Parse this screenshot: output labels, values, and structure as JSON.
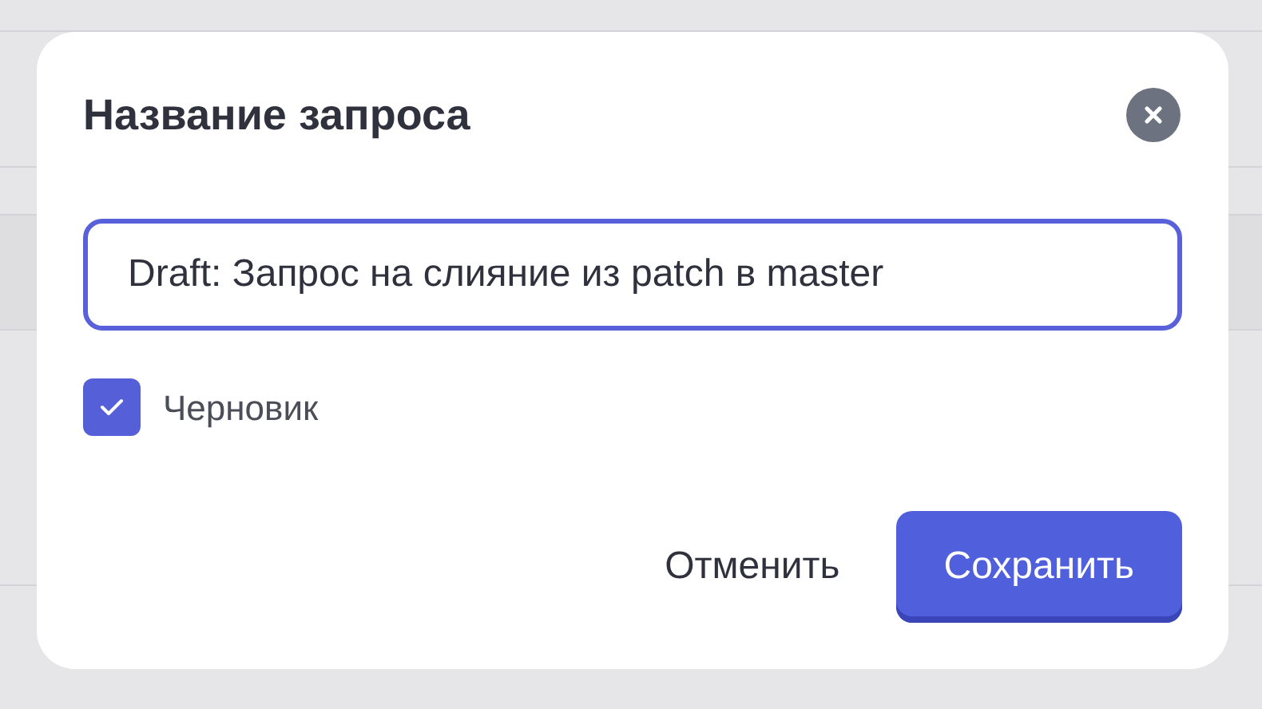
{
  "dialog": {
    "title": "Название запроса",
    "title_field": {
      "value": "Draft: Запрос на слияние из patch в master"
    },
    "draft_checkbox": {
      "label": "Черновик",
      "checked": true
    },
    "buttons": [
      {
        "label": "Отменить",
        "kind": "secondary"
      },
      {
        "label": "Сохранить",
        "kind": "primary"
      }
    ]
  }
}
